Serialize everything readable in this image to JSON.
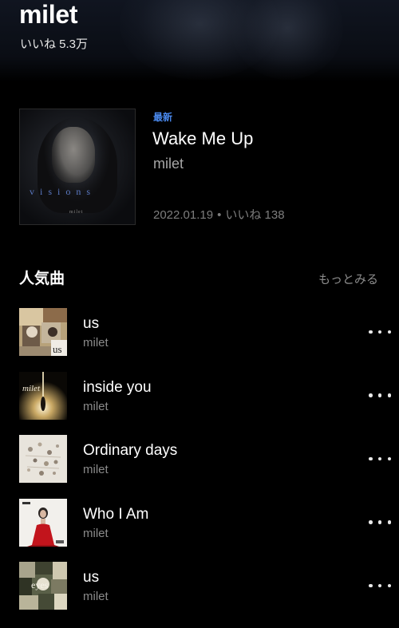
{
  "artist": {
    "name": "milet",
    "likes": "いいね 5.3万"
  },
  "latest": {
    "badge": "最新",
    "title": "Wake Me Up",
    "artist": "milet",
    "date": "2022.01.19",
    "separator": "•",
    "likes": "いいね 138",
    "cover_text": "visions",
    "cover_sub": "milet"
  },
  "popular": {
    "title": "人気曲",
    "more": "もっとみる",
    "songs": [
      {
        "title": "us",
        "artist": "milet",
        "art_label": "us",
        "art_icon": "collage-art"
      },
      {
        "title": "inside you",
        "artist": "milet",
        "art_label": "milet",
        "art_icon": "spotlight-art"
      },
      {
        "title": "Ordinary days",
        "artist": "milet",
        "art_label": "",
        "art_icon": "white-collage-art"
      },
      {
        "title": "Who I Am",
        "artist": "milet",
        "art_label": "",
        "art_icon": "red-dress-art"
      },
      {
        "title": "us",
        "artist": "milet",
        "art_label": "eyes",
        "art_icon": "eyes-collage-art"
      }
    ]
  },
  "colors": {
    "background": "#000000",
    "accent": "#4a8af0",
    "secondary_text": "#8a8a8a"
  }
}
